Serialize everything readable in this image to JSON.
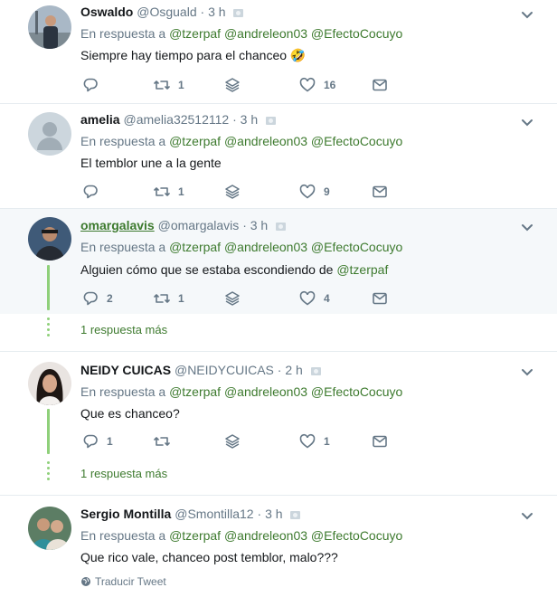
{
  "tweets": [
    {
      "name": "Oswaldo",
      "handle": "@Osguald",
      "time": "3 h",
      "reply_prefix": "En respuesta a",
      "mentions": [
        "@tzerpaf",
        "@andreleon03",
        "@EfectoCocuyo"
      ],
      "text": "Siempre hay tiempo para el chanceo 🤣",
      "replies": "",
      "retweets": "1",
      "likes": "16"
    },
    {
      "name": "amelia",
      "handle": "@amelia32512112",
      "time": "3 h",
      "reply_prefix": "En respuesta a",
      "mentions": [
        "@tzerpaf",
        "@andreleon03",
        "@EfectoCocuyo"
      ],
      "text": "El temblor une a la gente",
      "replies": "",
      "retweets": "1",
      "likes": "9"
    },
    {
      "name": "omargalavis",
      "handle": "@omargalavis",
      "time": "3 h",
      "reply_prefix": "En respuesta a",
      "mentions": [
        "@tzerpaf",
        "@andreleon03",
        "@EfectoCocuyo"
      ],
      "text_before": "Alguien cómo que se estaba escondiendo de",
      "text_mention": "@tzerpaf",
      "replies": "2",
      "retweets": "1",
      "likes": "4",
      "more_replies": "1 respuesta más"
    },
    {
      "name": "NEIDY CUICAS",
      "handle": "@NEIDYCUICAS",
      "time": "2 h",
      "reply_prefix": "En respuesta a",
      "mentions": [
        "@tzerpaf",
        "@andreleon03",
        "@EfectoCocuyo"
      ],
      "text": "Que es chanceo?",
      "replies": "1",
      "retweets": "",
      "likes": "1",
      "more_replies": "1 respuesta más"
    },
    {
      "name": "Sergio Montilla",
      "handle": "@Smontilla12",
      "time": "3 h",
      "reply_prefix": "En respuesta a",
      "mentions": [
        "@tzerpaf",
        "@andreleon03",
        "@EfectoCocuyo"
      ],
      "text": "Que rico vale, chanceo post temblor, malo???",
      "translate": "Traducir Tweet"
    }
  ],
  "separator": "·",
  "colors": {
    "link_green": "#3d7a2e",
    "thread_green": "#8fd07a",
    "muted": "#657786",
    "highlight_bg": "#f5f8fa"
  }
}
